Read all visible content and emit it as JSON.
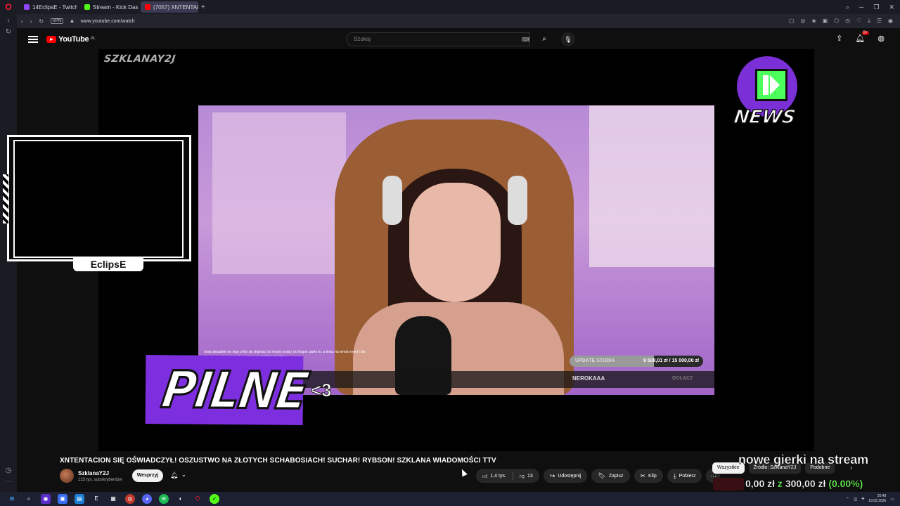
{
  "browser": {
    "tabs": [
      {
        "label": "14EclipsE - Twitch",
        "color": "#9146ff"
      },
      {
        "label": "Stream - Kick Dashboard",
        "color": "#53fc18"
      },
      {
        "label": "(7057) XNTENTACION...",
        "color": "#ff0000"
      }
    ],
    "vpn_label": "VPN",
    "url": "www.youtube.com/watch"
  },
  "youtube": {
    "logo_text": "YouTube",
    "country": "PL",
    "search_placeholder": "Szukaj",
    "notification_count": "9+"
  },
  "video": {
    "channel_watermark": "SZKLANAY2J",
    "news_label": "NEWS",
    "cam_label": "EclipsE",
    "pilne_label": "PILNE",
    "heart_text": "<3",
    "chat_text": "moja aktualnie do tego żeby się dojebać do twojej osoby, bo kogoś ujarło to, a teraz na temat event i tak ciągnie ten temat na siłę pomimo że totalnie nie ma ...",
    "donation_label": "UPDATE STUDIA",
    "donation_value": "9 508,01 zł / 15 000,00 zł",
    "donation_progress": 0.63,
    "ticker_name": "NEROKAAA",
    "ticker_action": "DOŁĄCZ"
  },
  "below_video": {
    "title": "XNTENTACION SIĘ OŚWIADCZYŁ! OSZUSTWO NA ZŁOTYCH SCHABOSIACH! SUCHAR! RYBSON! SZKLANA WIADOMOŚCI TTV",
    "channel_name": "SzklanaY2J",
    "subscribers": "123 tys. subskrybentów",
    "support_label": "Wesprzyj",
    "likes": "1,4 tys.",
    "dislikes": "13",
    "share_label": "Udostępnij",
    "save_label": "Zapisz",
    "clip_label": "Klip",
    "download_label": "Pobierz"
  },
  "chips": {
    "all": "Wszystkie",
    "source": "Źródło: SzklanaY2J",
    "related": "Podobne"
  },
  "stream_overlay": {
    "headline": "nowe gierki na stream",
    "goal_current": "0,00 zł",
    "goal_middle": " z ",
    "goal_target": "300,00 zł",
    "goal_percent": "(0.00%)"
  },
  "taskbar": {
    "time": "20:48",
    "date": "19.02.2026"
  }
}
